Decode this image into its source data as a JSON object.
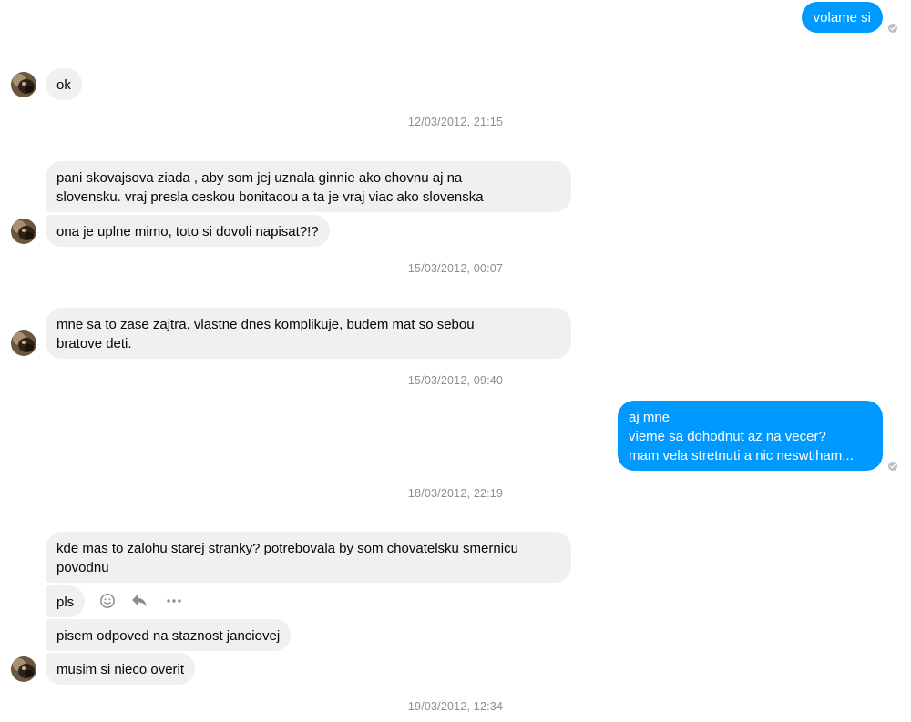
{
  "conversation": {
    "messages": {
      "m1": "volame si",
      "m2": "ok",
      "m3": "pani skovajsova ziada , aby som jej uznala ginnie ako chovnu aj na\nslovensku. vraj presla ceskou bonitacou a ta je vraj viac ako slovenska",
      "m4": "ona je uplne mimo, toto si dovoli napisat?!?",
      "m5": "mne sa to zase zajtra, vlastne dnes komplikuje, budem mat so sebou\nbratove deti.",
      "m6": "aj mne\nvieme sa dohodnut az na vecer?\nmam vela stretnuti a nic neswtiham...",
      "m7": "kde mas to zalohu starej stranky? potrebovala by som chovatelsku smernicu\npovodnu",
      "m8": "pls",
      "m9": "pisem odpoved na staznost janciovej",
      "m10": "musim si nieco overit"
    },
    "timestamps": {
      "t1": "12/03/2012, 21:15",
      "t2": "15/03/2012, 00:07",
      "t3": "15/03/2012, 09:40",
      "t4": "18/03/2012, 22:19",
      "t5": "19/03/2012, 12:34"
    },
    "hover_actions": [
      "smiley-icon",
      "reply-icon",
      "more-icon"
    ],
    "status_icon": "seen-check-icon"
  },
  "colors": {
    "outgoing_bubble": "#0099ff",
    "incoming_bubble": "#f0f0f0",
    "timestamp_text": "#8a8d91",
    "seen_indicator": "#bcc0c4"
  }
}
